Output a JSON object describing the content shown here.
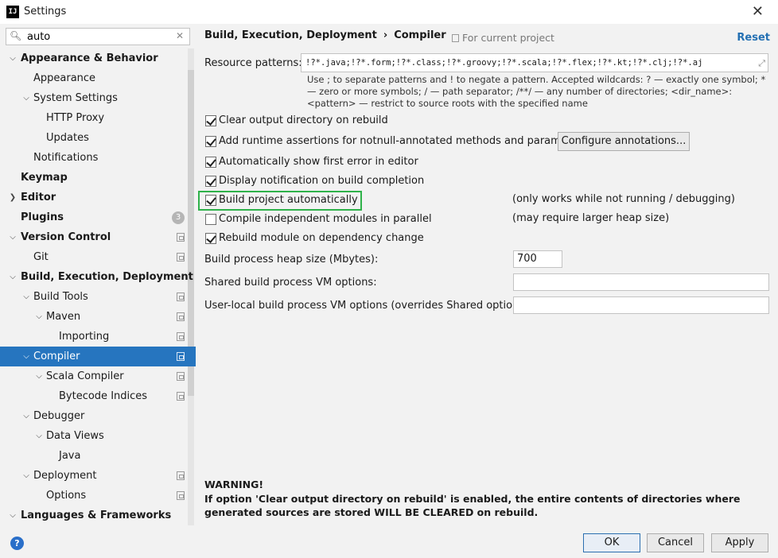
{
  "window": {
    "title": "Settings",
    "app_icon": "IJ"
  },
  "search": {
    "value": "auto"
  },
  "sidebar": {
    "items": [
      {
        "label": "Appearance & Behavior",
        "bold": true
      },
      {
        "label": "Appearance"
      },
      {
        "label": "System Settings"
      },
      {
        "label": "HTTP Proxy"
      },
      {
        "label": "Updates"
      },
      {
        "label": "Notifications"
      },
      {
        "label": "Keymap",
        "bold": true
      },
      {
        "label": "Editor",
        "bold": true
      },
      {
        "label": "Plugins",
        "bold": true,
        "badge": "3"
      },
      {
        "label": "Version Control",
        "bold": true
      },
      {
        "label": "Git"
      },
      {
        "label": "Build, Execution, Deployment",
        "bold": true
      },
      {
        "label": "Build Tools"
      },
      {
        "label": "Maven"
      },
      {
        "label": "Importing"
      },
      {
        "label": "Compiler",
        "selected": true
      },
      {
        "label": "Scala Compiler"
      },
      {
        "label": "Bytecode Indices"
      },
      {
        "label": "Debugger"
      },
      {
        "label": "Data Views"
      },
      {
        "label": "Java"
      },
      {
        "label": "Deployment"
      },
      {
        "label": "Options"
      },
      {
        "label": "Languages & Frameworks",
        "bold": true
      }
    ]
  },
  "header": {
    "breadcrumb_parent": "Build, Execution, Deployment",
    "breadcrumb_separator": "›",
    "breadcrumb_current": "Compiler",
    "scope_label": "For current project",
    "reset_label": "Reset"
  },
  "resource_patterns": {
    "label": "Resource patterns:",
    "value": "!?*.java;!?*.form;!?*.class;!?*.groovy;!?*.scala;!?*.flex;!?*.kt;!?*.clj;!?*.aj",
    "hint": "Use ; to separate patterns and ! to negate a pattern. Accepted wildcards: ? — exactly one symbol; * — zero or more symbols; / — path separator; /**/ — any number of directories; <dir_name>:<pattern> — restrict to source roots with the specified name"
  },
  "options": {
    "clear_output": {
      "label": "Clear output directory on rebuild",
      "checked": true
    },
    "runtime_assertions": {
      "label": "Add runtime assertions for notnull-annotated methods and parameters",
      "checked": true
    },
    "configure_annotations_label": "Configure annotations...",
    "show_first_error": {
      "label": "Automatically show first error in editor",
      "checked": true
    },
    "display_notification": {
      "label": "Display notification on build completion",
      "checked": true
    },
    "build_automatically": {
      "label": "Build project automatically",
      "checked": true,
      "note": "(only works while not running / debugging)"
    },
    "compile_parallel": {
      "label": "Compile independent modules in parallel",
      "checked": false,
      "note": "(may require larger heap size)"
    },
    "rebuild_on_dependency": {
      "label": "Rebuild module on dependency change",
      "checked": true
    }
  },
  "heap": {
    "label": "Build process heap size (Mbytes):",
    "value": "700"
  },
  "shared_vm": {
    "label": "Shared build process VM options:",
    "value": ""
  },
  "user_vm": {
    "label": "User-local build process VM options (overrides Shared options):",
    "value": ""
  },
  "warning": {
    "title": "WARNING!",
    "text": "If option 'Clear output directory on rebuild' is enabled, the entire contents of directories where generated sources are stored WILL BE CLEARED on rebuild."
  },
  "footer": {
    "ok_label": "OK",
    "cancel_label": "Cancel",
    "apply_label": "Apply",
    "help_icon": "?"
  },
  "colors": {
    "selection": "#2675bf",
    "highlight_border": "#2fb24a",
    "link": "#2470b3"
  }
}
